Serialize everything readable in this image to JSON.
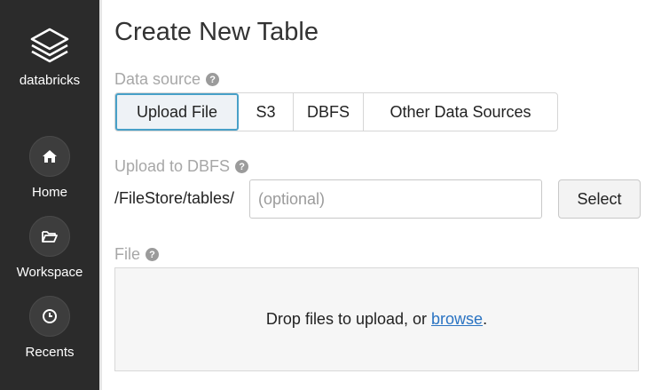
{
  "sidebar": {
    "brand": {
      "icon": "layers-icon",
      "name": "databricks"
    },
    "items": [
      {
        "icon": "home-icon",
        "label": "Home"
      },
      {
        "icon": "folder-open-icon",
        "label": "Workspace"
      },
      {
        "icon": "clock-icon",
        "label": "Recents"
      }
    ]
  },
  "page": {
    "title": "Create New Table"
  },
  "data_source": {
    "label": "Data source",
    "help_icon": "question-icon",
    "options": [
      {
        "label": "Upload File",
        "selected": true
      },
      {
        "label": "S3",
        "selected": false
      },
      {
        "label": "DBFS",
        "selected": false
      },
      {
        "label": "Other Data Sources",
        "selected": false
      }
    ]
  },
  "upload_to_dbfs": {
    "label": "Upload to DBFS",
    "help_icon": "question-icon",
    "path_prefix": "/FileStore/tables/",
    "input_value": "",
    "input_placeholder": "(optional)",
    "select_label": "Select"
  },
  "file": {
    "label": "File",
    "help_icon": "question-icon",
    "drop_text": "Drop files to upload, or ",
    "browse_link": "browse",
    "drop_text_end": "."
  },
  "colors": {
    "sidebar_bg": "#2b2b2b",
    "active_border": "#48a0c8",
    "link": "#2a73c2"
  }
}
